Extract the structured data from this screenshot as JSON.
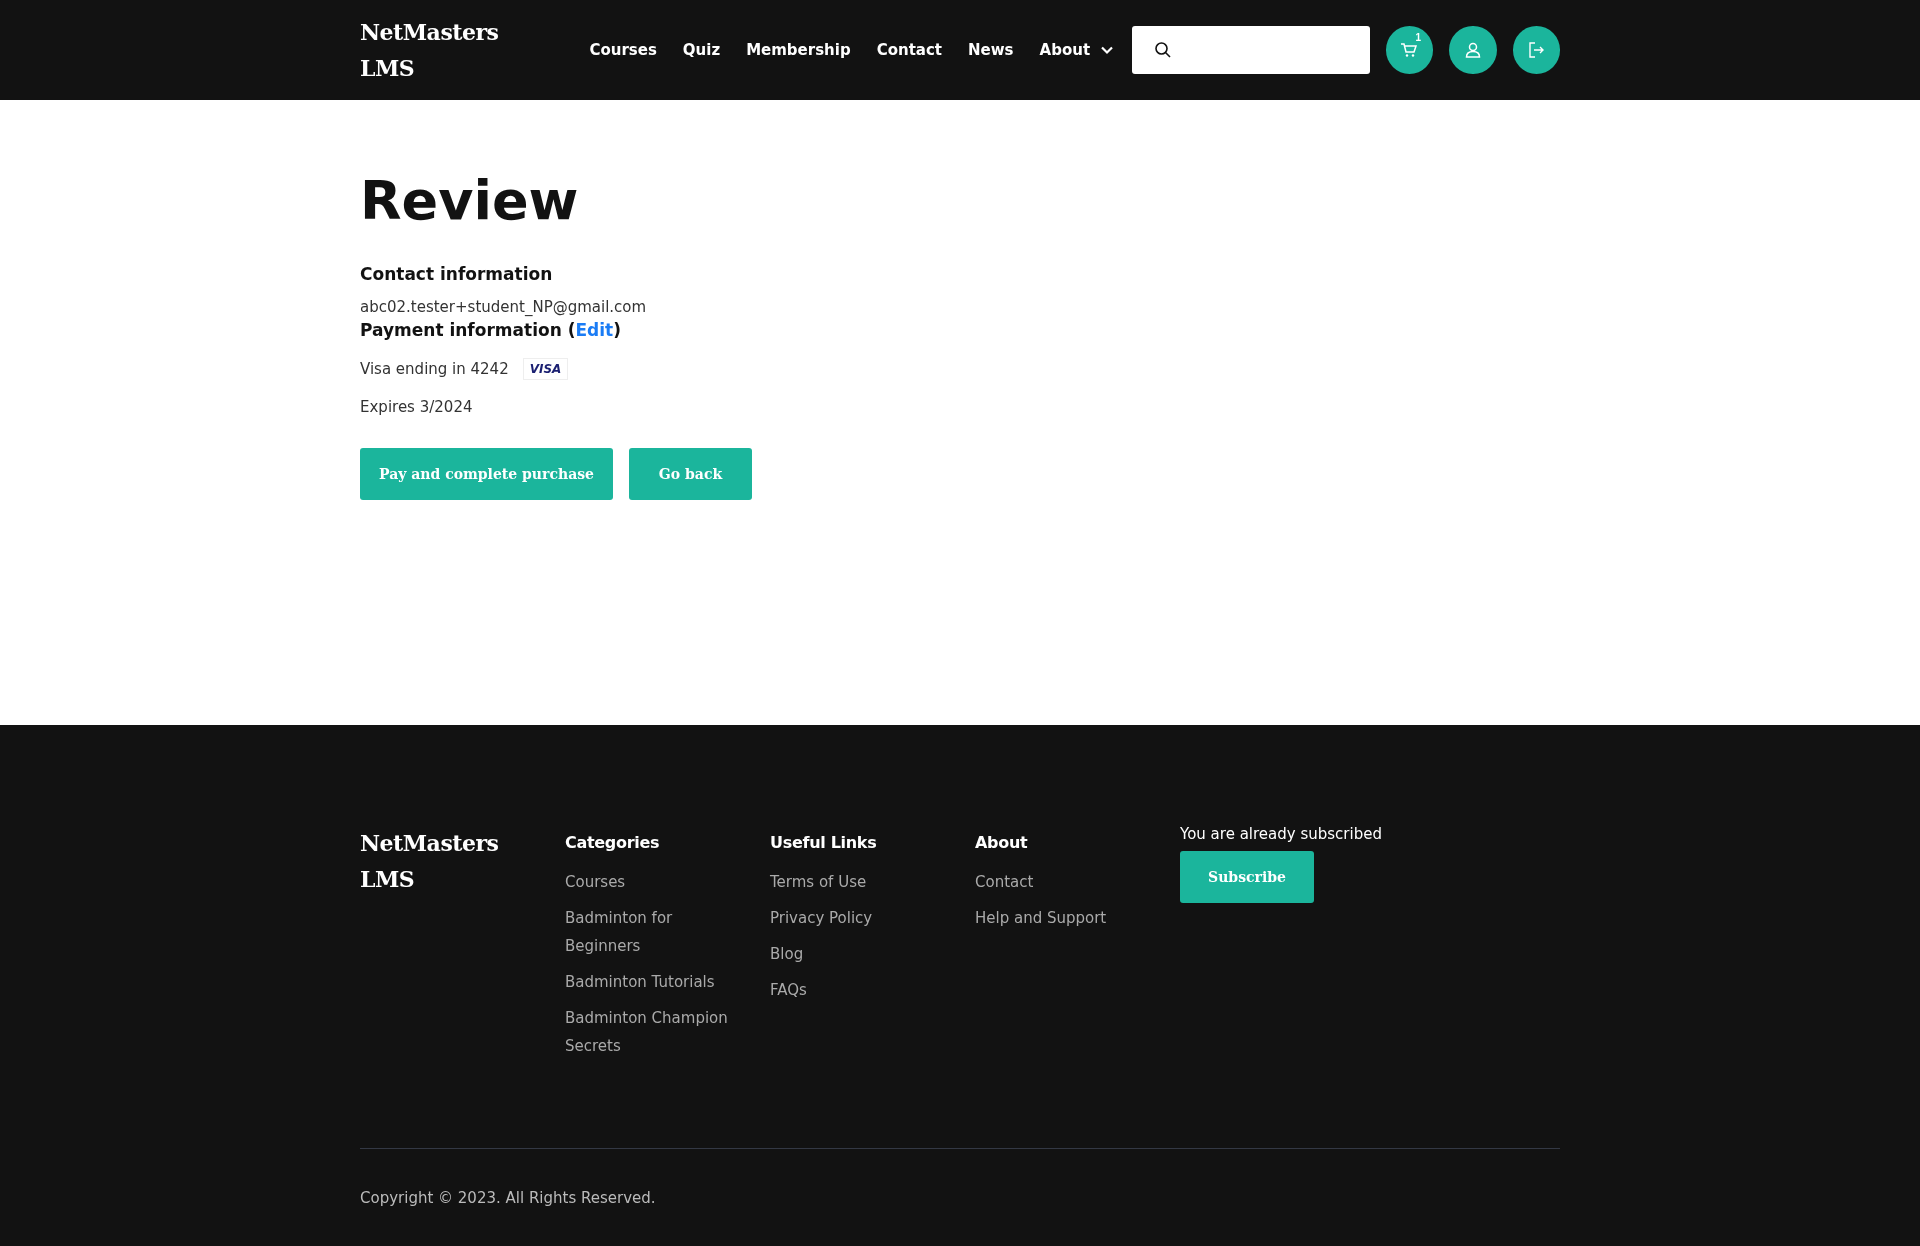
{
  "header": {
    "logo": [
      "NetMasters",
      "LMS"
    ],
    "nav": [
      {
        "label": "Courses",
        "dropdown": false
      },
      {
        "label": "Quiz",
        "dropdown": false
      },
      {
        "label": "Membership",
        "dropdown": false
      },
      {
        "label": "Contact",
        "dropdown": false
      },
      {
        "label": "News",
        "dropdown": false
      },
      {
        "label": "About",
        "dropdown": true
      }
    ],
    "cart_count": "1"
  },
  "review": {
    "title": "Review",
    "contact_heading": "Contact information",
    "email": "abc02.tester+student_NP@gmail.com",
    "payment_heading": "Payment information (",
    "payment_link": "Edit",
    "payment_close": ")",
    "card_text": "Visa ending in 4242",
    "card_brand": "VISA",
    "expires": "Expires 3/2024",
    "buttons": [
      "Pay and complete purchase",
      "Go back"
    ]
  },
  "footer": {
    "logo": [
      "NetMasters",
      "LMS"
    ],
    "columns": [
      {
        "heading": "Categories",
        "links": [
          "Courses",
          "Badminton for Beginners",
          "Badminton Tutorials",
          "Badminton Champion Secrets"
        ]
      },
      {
        "heading": "Useful Links",
        "links": [
          "Terms of Use",
          "Privacy Policy",
          "Blog",
          "FAQs"
        ]
      },
      {
        "heading": "About",
        "links": [
          "Contact",
          "Help and Support"
        ]
      }
    ],
    "subscribe_note": "You are already subscribed",
    "subscribe_button": "Subscribe",
    "copyright": "Copyright © 2023. All Rights Reserved."
  }
}
